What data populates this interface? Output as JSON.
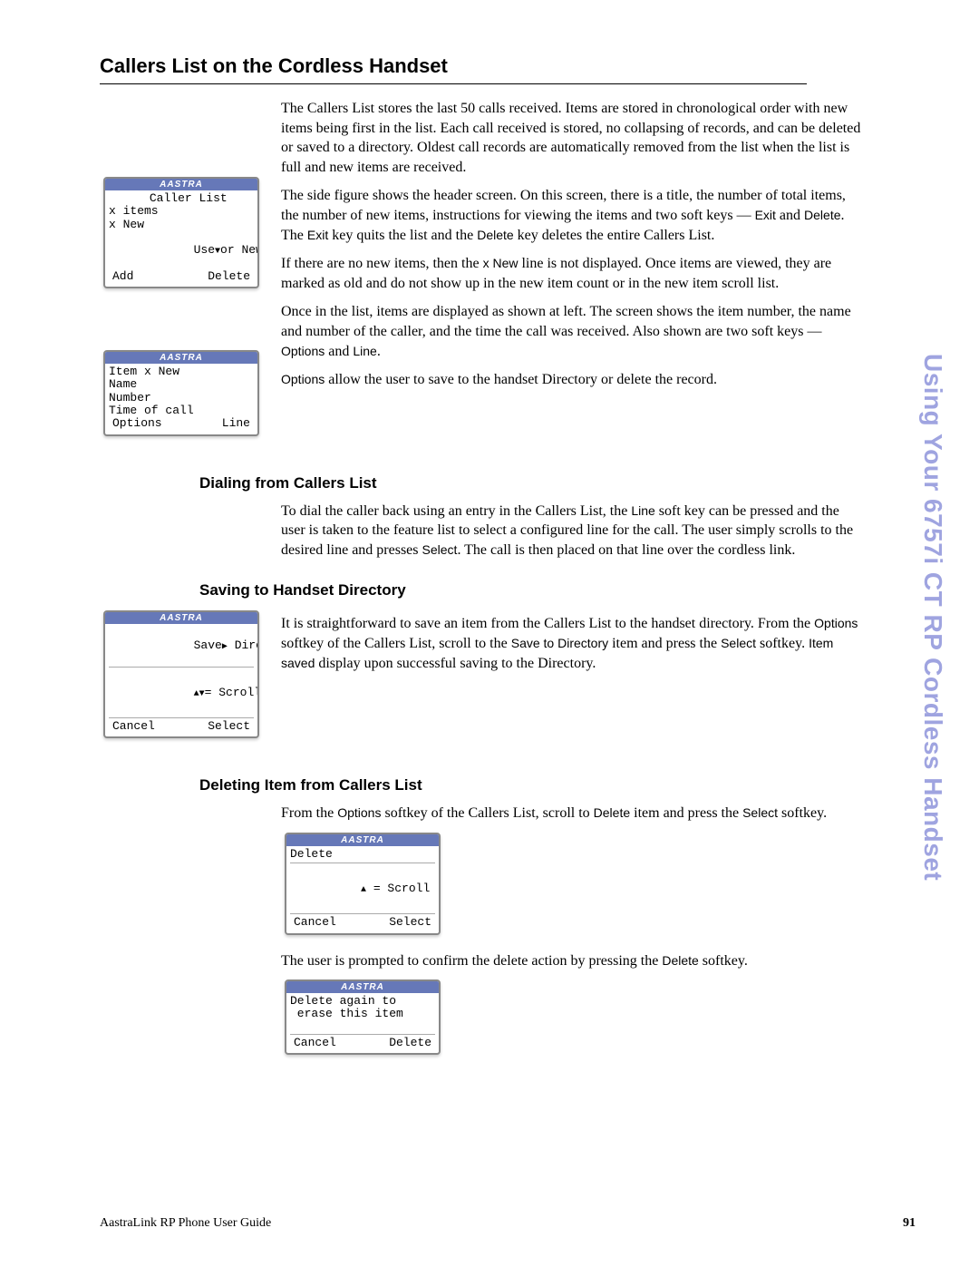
{
  "side_title": "Using Your 6757i CT RP Cordless Handset",
  "h1": "Callers List on the Cordless Handset",
  "intro": {
    "p1": "The Callers List stores the last 50 calls received. Items are stored in chronological order with new items being first in the list. Each call received is stored, no collapsing of records, and can be deleted or saved to a directory. Oldest call records are automatically removed from the list when the list is full and new items are received.",
    "p2a": "The side figure shows the header screen. On this screen, there is a title, the number of total items, the number of new items, instructions for viewing the items and two soft keys — ",
    "p2_exit": "Exit",
    "p2b": " and ",
    "p2_del": "Delete",
    "p2c": ". The ",
    "p2_exit2": "Exit",
    "p2d": " key quits the list and the ",
    "p2_del2": "Delete",
    "p2e": " key deletes the entire Callers List.",
    "p3a": "If there are no new items, then the ",
    "p3_xnew": "x New",
    "p3b": " line is not displayed. Once items are viewed, they are marked as old and do not show up in the new item count or in the new item scroll list.",
    "p4a": "Once in the list, items are displayed as shown at left. The screen shows the item number, the name and number of the caller, and the time the call was received. Also shown are two soft keys — ",
    "p4_opt": "Options",
    "p4b": " and ",
    "p4_line": "Line",
    "p4c": ".",
    "p5a": "Options",
    "p5b": " allow the user to save to the handset Directory or delete the record."
  },
  "lcd1": {
    "brand": "AASTRA",
    "l1": "  Caller List",
    "l2": "x items",
    "l3": "x New",
    "l4a": "Use",
    "l4b": "or",
    "l4c": " New",
    "fl": "Add",
    "fr": "Delete"
  },
  "lcd2": {
    "brand": "AASTRA",
    "l1": "Item x New",
    "l2": "Name",
    "l3": "Number",
    "l4": "Time of call",
    "fl": "Options",
    "fr": "Line"
  },
  "dial": {
    "h": "Dialing from Callers List",
    "p_a": "To dial the caller back using an entry in the Callers List, the ",
    "p_line": "Line",
    "p_b": " soft key can be pressed and the user is taken to the feature list to select a configured line for the call. The user simply scrolls to the desired line and presses ",
    "p_select": "Select",
    "p_c": ". The call is then placed on that line over the cordless link."
  },
  "save": {
    "h": "Saving to Handset Directory",
    "p_a": "It is straightforward to save an item from the Callers List to the handset directory. From the ",
    "p_opt": "Options",
    "p_b": " softkey of the Callers List, scroll to the ",
    "p_savedir": "Save to Directory",
    "p_c": " item and press the ",
    "p_select": "Select",
    "p_d": " softkey. ",
    "p_itemsaved": "Item saved",
    "p_e": " display upon successful saving to the Directory."
  },
  "lcd3": {
    "brand": "AASTRA",
    "l1a": "Save",
    "l1b": "Directory",
    "mid": "= Scroll",
    "fl": "Cancel",
    "fr": "Select"
  },
  "del": {
    "h": "Deleting Item from Callers List",
    "p_a": "From the ",
    "p_opt": "Options",
    "p_b": " softkey of the Callers List, scroll to ",
    "p_delete": "Delete",
    "p_c": " item and press the ",
    "p_select": "Select",
    "p_d": " softkey.",
    "p2a": "The user is prompted to confirm the delete action by pressing the ",
    "p2_delete": "Delete",
    "p2b": " softkey."
  },
  "lcd4": {
    "brand": "AASTRA",
    "l1": "Delete",
    "mid": " = Scroll",
    "fl": "Cancel",
    "fr": "Select"
  },
  "lcd5": {
    "brand": "AASTRA",
    "l1": "Delete again to",
    "l2": " erase this item",
    "fl": "Cancel",
    "fr": "Delete"
  },
  "footer": {
    "left": "AastraLink RP Phone User Guide",
    "right": "91"
  }
}
